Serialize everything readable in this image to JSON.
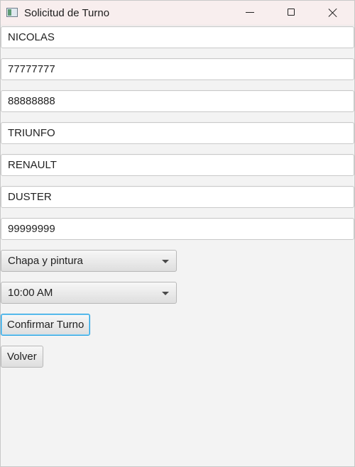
{
  "window": {
    "title": "Solicitud de Turno"
  },
  "form": {
    "fields": [
      "NICOLAS",
      "77777777",
      "88888888",
      "TRIUNFO",
      "RENAULT",
      "DUSTER",
      "99999999"
    ],
    "service_select": "Chapa y pintura",
    "time_select": "10:00 AM",
    "confirm_button": "Confirmar Turno",
    "back_button": "Volver"
  },
  "icons": {
    "app": "app-window-icon",
    "minimize": "minimize-icon",
    "maximize": "maximize-icon",
    "close": "close-icon",
    "dropdown": "chevron-down-icon"
  },
  "colors": {
    "background": "#f3f3f3",
    "titlebar": "#f8eeee",
    "focus_border": "#1f9fe0"
  }
}
